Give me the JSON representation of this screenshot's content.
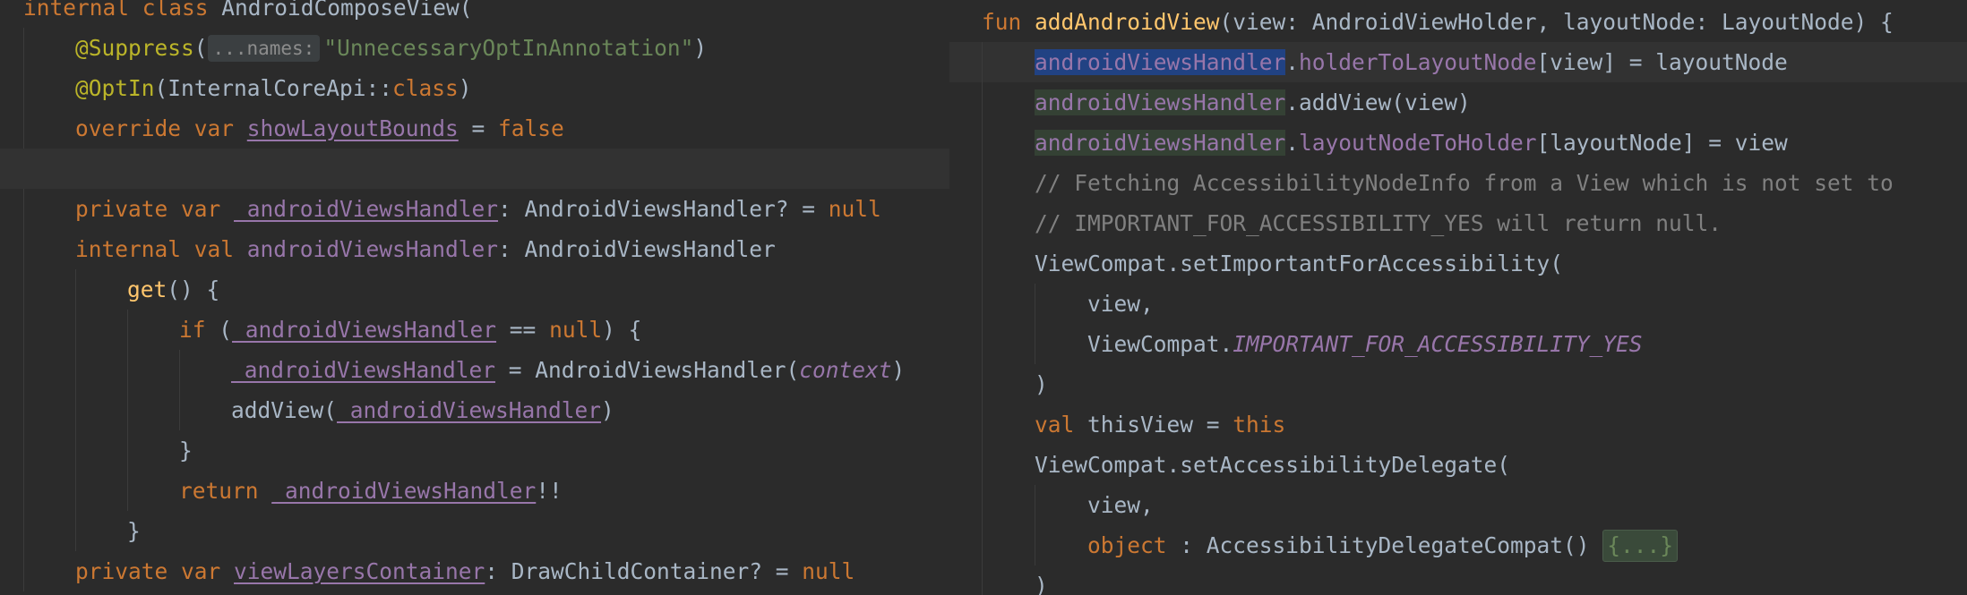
{
  "left_editor": {
    "lines": [
      {
        "indent": 0,
        "tokens": [
          {
            "t": "internal class ",
            "c": "kw"
          },
          {
            "t": "AndroidComposeView(",
            "c": "plain"
          }
        ]
      },
      {
        "indent": 1,
        "tokens": [
          {
            "t": "@Suppress",
            "c": "ann"
          },
          {
            "t": "(",
            "c": "plain"
          },
          {
            "t": "...names:",
            "c": "hint"
          },
          {
            "t": "\"UnnecessaryOptInAnnotation\"",
            "c": "str"
          },
          {
            "t": ")",
            "c": "plain"
          }
        ]
      },
      {
        "indent": 1,
        "tokens": [
          {
            "t": "@OptIn",
            "c": "ann"
          },
          {
            "t": "(InternalCoreApi::",
            "c": "plain"
          },
          {
            "t": "class",
            "c": "kw"
          },
          {
            "t": ")",
            "c": "plain"
          }
        ]
      },
      {
        "indent": 1,
        "tokens": [
          {
            "t": "override var ",
            "c": "kw"
          },
          {
            "t": "showLayoutBounds",
            "c": "prop-u"
          },
          {
            "t": " = ",
            "c": "plain"
          },
          {
            "t": "false",
            "c": "kw"
          }
        ]
      },
      {
        "indent": 0,
        "caret": true,
        "tokens": []
      },
      {
        "indent": 1,
        "tokens": [
          {
            "t": "private var ",
            "c": "kw"
          },
          {
            "t": "_androidViewsHandler",
            "c": "prop-u"
          },
          {
            "t": ": AndroidViewsHandler? = ",
            "c": "plain"
          },
          {
            "t": "null",
            "c": "kw"
          }
        ]
      },
      {
        "indent": 1,
        "tokens": [
          {
            "t": "internal val ",
            "c": "kw"
          },
          {
            "t": "androidViewsHandler",
            "c": "prop"
          },
          {
            "t": ": AndroidViewsHandler",
            "c": "plain"
          }
        ]
      },
      {
        "indent": 2,
        "tokens": [
          {
            "t": "get",
            "c": "fn"
          },
          {
            "t": "() {",
            "c": "plain"
          }
        ]
      },
      {
        "indent": 3,
        "tokens": [
          {
            "t": "if ",
            "c": "kw"
          },
          {
            "t": "(",
            "c": "plain"
          },
          {
            "t": "_androidViewsHandler",
            "c": "prop-u"
          },
          {
            "t": " == ",
            "c": "plain"
          },
          {
            "t": "null",
            "c": "kw"
          },
          {
            "t": ") {",
            "c": "plain"
          }
        ]
      },
      {
        "indent": 4,
        "tokens": [
          {
            "t": "_androidViewsHandler",
            "c": "prop-u"
          },
          {
            "t": " = AndroidViewsHandler(",
            "c": "plain"
          },
          {
            "t": "context",
            "c": "param"
          },
          {
            "t": ")",
            "c": "plain"
          }
        ]
      },
      {
        "indent": 4,
        "tokens": [
          {
            "t": "addView(",
            "c": "plain"
          },
          {
            "t": "_androidViewsHandler",
            "c": "prop-u"
          },
          {
            "t": ")",
            "c": "plain"
          }
        ]
      },
      {
        "indent": 3,
        "tokens": [
          {
            "t": "}",
            "c": "plain"
          }
        ]
      },
      {
        "indent": 3,
        "tokens": [
          {
            "t": "return ",
            "c": "kw"
          },
          {
            "t": "_androidViewsHandler",
            "c": "prop-u"
          },
          {
            "t": "!!",
            "c": "plain"
          }
        ]
      },
      {
        "indent": 2,
        "tokens": [
          {
            "t": "}",
            "c": "plain"
          }
        ]
      },
      {
        "indent": 1,
        "tokens": [
          {
            "t": "private var ",
            "c": "kw"
          },
          {
            "t": "viewLayersContainer",
            "c": "prop-u"
          },
          {
            "t": ": DrawChildContainer? = ",
            "c": "plain"
          },
          {
            "t": "null",
            "c": "kw"
          }
        ]
      }
    ]
  },
  "right_editor": {
    "lines": [
      {
        "indent": 0,
        "tokens": [
          {
            "t": "fun ",
            "c": "kw"
          },
          {
            "t": "addAndroidView",
            "c": "fn"
          },
          {
            "t": "(view: AndroidViewHolder, layoutNode: LayoutNode) {",
            "c": "plain"
          }
        ]
      },
      {
        "indent": 1,
        "caret": true,
        "tokens": [
          {
            "t": "androidViewsHandler",
            "c": "prop hl-blue"
          },
          {
            "t": ".",
            "c": "plain"
          },
          {
            "t": "holderToLayoutNode",
            "c": "prop"
          },
          {
            "t": "[view] = layoutNode",
            "c": "plain"
          }
        ]
      },
      {
        "indent": 1,
        "tokens": [
          {
            "t": "androidViewsHandler",
            "c": "prop hl-green"
          },
          {
            "t": ".addView(view)",
            "c": "plain"
          }
        ]
      },
      {
        "indent": 1,
        "tokens": [
          {
            "t": "androidViewsHandler",
            "c": "prop hl-green"
          },
          {
            "t": ".",
            "c": "plain"
          },
          {
            "t": "layoutNodeToHolder",
            "c": "prop"
          },
          {
            "t": "[layoutNode] = view",
            "c": "plain"
          }
        ]
      },
      {
        "indent": 1,
        "tokens": [
          {
            "t": "// Fetching AccessibilityNodeInfo from a View which is not set to",
            "c": "cmt"
          }
        ]
      },
      {
        "indent": 1,
        "tokens": [
          {
            "t": "// IMPORTANT_FOR_ACCESSIBILITY_YES will return null.",
            "c": "cmt"
          }
        ]
      },
      {
        "indent": 1,
        "tokens": [
          {
            "t": "ViewCompat.setImportantForAccessibility(",
            "c": "plain"
          }
        ]
      },
      {
        "indent": 2,
        "tokens": [
          {
            "t": "view,",
            "c": "plain"
          }
        ]
      },
      {
        "indent": 2,
        "tokens": [
          {
            "t": "ViewCompat.",
            "c": "plain"
          },
          {
            "t": "IMPORTANT_FOR_ACCESSIBILITY_YES",
            "c": "const"
          }
        ]
      },
      {
        "indent": 1,
        "tokens": [
          {
            "t": ")",
            "c": "plain"
          }
        ]
      },
      {
        "indent": 1,
        "tokens": [
          {
            "t": "val ",
            "c": "kw"
          },
          {
            "t": "thisView = ",
            "c": "plain"
          },
          {
            "t": "this",
            "c": "kw"
          }
        ]
      },
      {
        "indent": 1,
        "tokens": [
          {
            "t": "ViewCompat.setAccessibilityDelegate(",
            "c": "plain"
          }
        ]
      },
      {
        "indent": 2,
        "tokens": [
          {
            "t": "view,",
            "c": "plain"
          }
        ]
      },
      {
        "indent": 2,
        "tokens": [
          {
            "t": "object ",
            "c": "kw"
          },
          {
            "t": ": AccessibilityDelegateCompat() ",
            "c": "plain"
          },
          {
            "t": "{...}",
            "c": "fold"
          }
        ]
      },
      {
        "indent": 1,
        "tokens": [
          {
            "t": ")",
            "c": "plain"
          }
        ]
      }
    ]
  },
  "colors": {
    "background": "#2b2b2b",
    "caret_row": "#323232",
    "keyword": "#cc7832",
    "annotation": "#bbb529",
    "string": "#6a8759",
    "function": "#ffc66d",
    "property": "#9876aa",
    "comment": "#808080",
    "text": "#a9b7c6",
    "usage_highlight_write": "#214283",
    "usage_highlight_read": "#344134"
  }
}
